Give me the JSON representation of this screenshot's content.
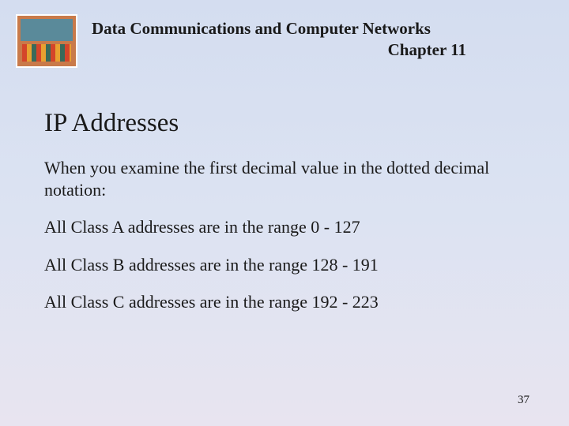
{
  "header": {
    "course_title": "Data Communications and Computer Networks",
    "chapter": "Chapter 11"
  },
  "slide": {
    "title": "IP Addresses",
    "intro": "When you examine the first decimal value in the dotted decimal notation:",
    "bullets": [
      "All Class A addresses are in the range 0 - 127",
      "All Class B addresses are in the range 128 - 191",
      "All Class C addresses are in the range 192 - 223"
    ]
  },
  "page_number": "37"
}
